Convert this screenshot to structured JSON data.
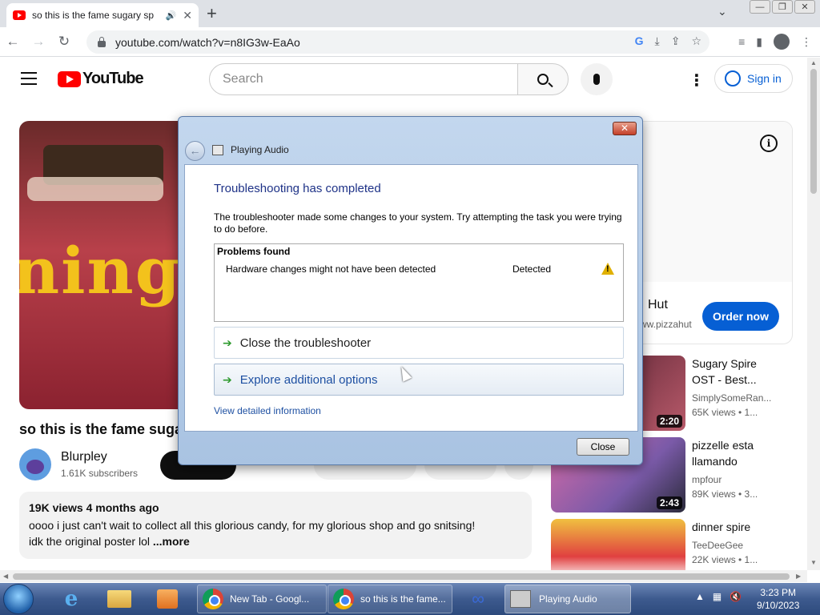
{
  "browser": {
    "tab_title": "so this is the fame sugary sp",
    "new_tab_symbol": "+",
    "url": "youtube.com/watch?v=n8IG3w-EaAo"
  },
  "youtube": {
    "logo_text": "YouTube",
    "search_placeholder": "Search",
    "sign_in": "Sign in",
    "video_overlay_text": "nings",
    "video_title": "so this is the fame sugary spire",
    "channel_name": "Blurpley",
    "channel_subs": "1.61K subscribers",
    "description": {
      "meta": "19K views  4 months ago",
      "line1": "oooo i just can't wait to collect all this glorious candy, for my glorious shop and go snitsing!",
      "line2": "idk the original poster lol ",
      "more": "...more"
    },
    "ad": {
      "name": "Hut",
      "url": "ww.pizzahut",
      "cta": "Order now"
    },
    "recommendations": [
      {
        "title": "Sugary Spire OST - Best...",
        "channel": "SimplySomeRan...",
        "views": "65K views • 1...",
        "duration": "2:20",
        "color": "#7a2a3a"
      },
      {
        "title": "pizzelle esta llamando",
        "channel": "mpfour",
        "views": "89K views • 3...",
        "duration": "2:43",
        "color": "#c85a9a"
      },
      {
        "title": "dinner spire",
        "channel": "TeeDeeGee",
        "views": "22K views • 1...",
        "duration": "",
        "color": "#e04040"
      }
    ]
  },
  "dialog": {
    "window_title": "Playing Audio",
    "heading": "Troubleshooting has completed",
    "message": "The troubleshooter made some changes to your system. Try attempting the task you were trying to do before.",
    "problems_header": "Problems found",
    "problem_name": "Hardware changes might not have been detected",
    "problem_status": "Detected",
    "option_close": "Close the troubleshooter",
    "option_explore": "Explore additional options",
    "details_link": "View detailed information",
    "close_button": "Close"
  },
  "taskbar": {
    "items": [
      {
        "label": "New Tab - Googl..."
      },
      {
        "label": "so this is the fame..."
      },
      {
        "label": "Playing Audio"
      }
    ],
    "time": "3:23 PM",
    "date": "9/10/2023"
  }
}
